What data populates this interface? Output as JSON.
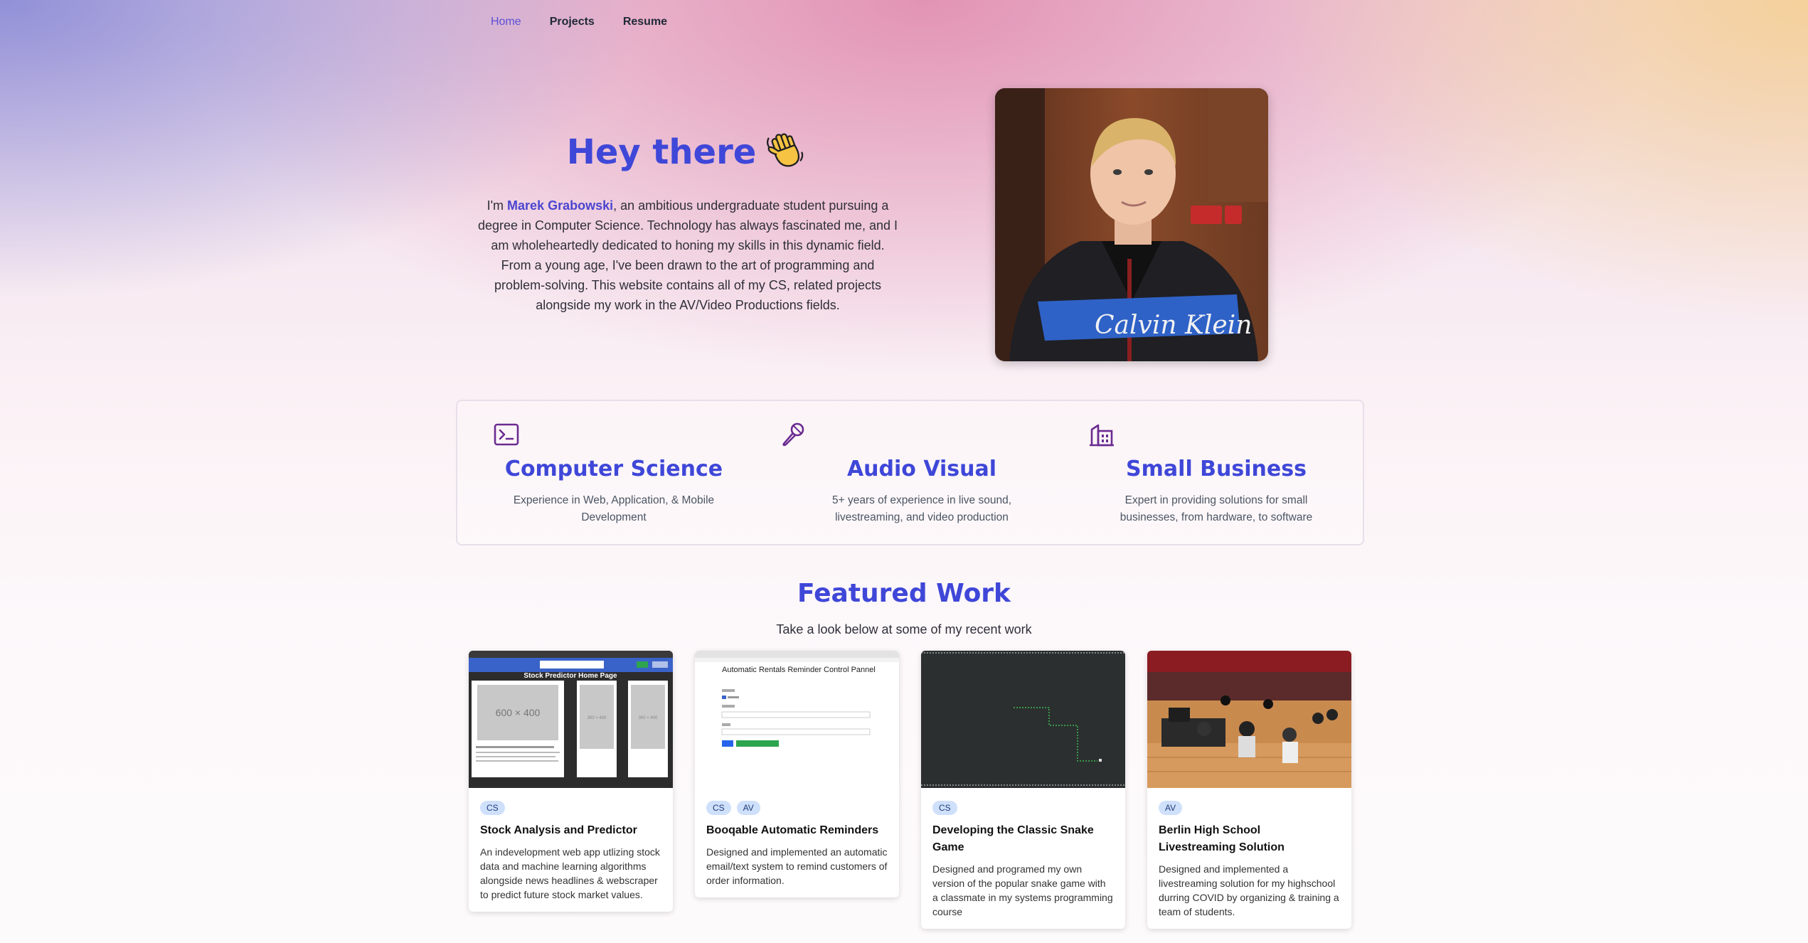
{
  "nav": {
    "home": "Home",
    "projects": "Projects",
    "resume": "Resume"
  },
  "hero": {
    "title": "Hey there",
    "intro_prefix": "I'm ",
    "name": "Marek Grabowski",
    "intro_body": ", an ambitious undergraduate student pursuing a degree in Computer Science. Technology has always fascinated me, and I am wholeheartedly dedicated to honing my skills in this dynamic field. From a young age, I've been drawn to the art of programming and problem-solving. This website contains all of my CS, related projects alongside my work in the AV/Video Productions fields.",
    "portrait_jacket_text": "Calvin Klein"
  },
  "skills": [
    {
      "icon": "terminal-icon",
      "title": "Computer Science",
      "desc": "Experience in Web, Application, & Mobile Development"
    },
    {
      "icon": "microphone-icon",
      "title": "Audio Visual",
      "desc": "5+ years of experience in live sound, livestreaming, and video production"
    },
    {
      "icon": "building-icon",
      "title": "Small Business",
      "desc": "Expert in providing solutions for small businesses, from hardware, to software"
    }
  ],
  "featured": {
    "title": "Featured Work",
    "subtitle": "Take a look below at some of my recent work",
    "cards": [
      {
        "tags": [
          "CS"
        ],
        "title": "Stock Analysis and Predictor",
        "desc": "An indevelopment web app utlizing stock data and machine learning algorithms alongside news headlines & webscraper to predict future stock market values.",
        "thumb": {
          "header": "Stock Predictor Home Page",
          "placeholder_main": "600 × 400",
          "placeholder_side": "300 × 400"
        }
      },
      {
        "tags": [
          "CS",
          "AV"
        ],
        "title": "Booqable Automatic Reminders",
        "desc": "Designed and implemented an automatic email/text system to remind customers of order information.",
        "thumb": {
          "header": "Automatic Rentals Reminder Control Pannel"
        }
      },
      {
        "tags": [
          "CS"
        ],
        "title": "Developing the Classic Snake Game",
        "desc": "Designed and programed my own version of the popular snake game with a classmate in my systems programming course"
      },
      {
        "tags": [
          "AV"
        ],
        "title": "Berlin High School Livestreaming Solution",
        "desc": "Designed and implemented a livestreaming solution for my highschool durring COVID by organizing & training a team of students."
      }
    ]
  },
  "colors": {
    "accent": "#3f47d8",
    "icon_purple": "#6b2c91",
    "badge_bg": "#cfe0fb"
  }
}
